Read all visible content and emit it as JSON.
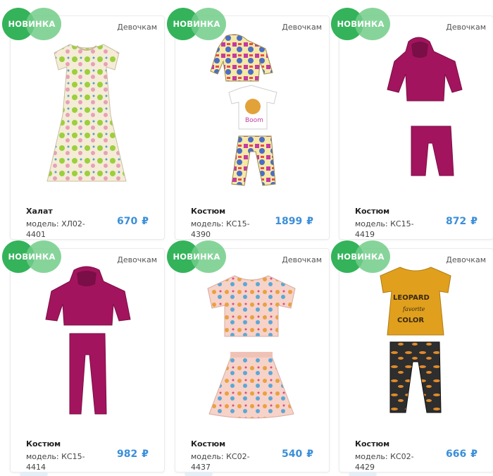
{
  "products": [
    {
      "badge": "НОВИНКА",
      "category": "Девочкам",
      "title": "Халат",
      "model_label": "модель: ХЛ02-4401",
      "price": "670",
      "currency": "₽"
    },
    {
      "badge": "НОВИНКА",
      "category": "Девочкам",
      "title": "Костюм",
      "model_label": "модель: КС15-4390",
      "price": "1899",
      "currency": "₽"
    },
    {
      "badge": "НОВИНКА",
      "category": "Девочкам",
      "title": "Костюм",
      "model_label": "модель: КС15-4419",
      "price": "872",
      "currency": "₽"
    },
    {
      "badge": "НОВИНКА",
      "category": "Девочкам",
      "title": "Костюм",
      "model_label": "модель: КС15-4414",
      "price": "982",
      "currency": "₽"
    },
    {
      "badge": "НОВИНКА",
      "category": "Девочкам",
      "title": "Костюм",
      "model_label": "модель: КС02-4437",
      "price": "540",
      "currency": "₽"
    },
    {
      "badge": "НОВИНКА",
      "category": "Девочкам",
      "title": "Костюм",
      "model_label": "модель: КС02-4429",
      "price": "666",
      "currency": "₽"
    }
  ],
  "colors": {
    "badge": "#34b35a",
    "price": "#3b8fd9",
    "magenta": "#a3145e",
    "mustard": "#e0a01e"
  }
}
